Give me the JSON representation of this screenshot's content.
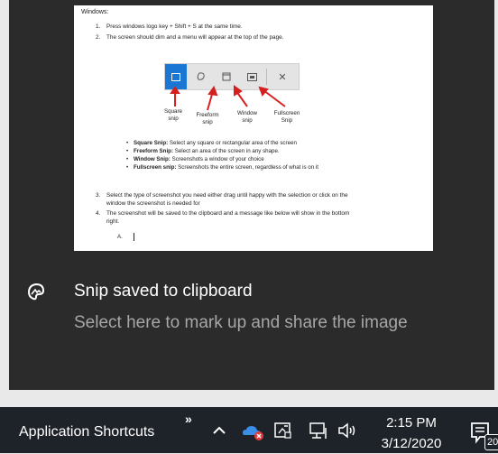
{
  "toast": {
    "title": "Snip saved to clipboard",
    "body": "Select here to mark up and share the image",
    "app_icon": "snip-sketch-icon"
  },
  "preview": {
    "heading": "Windows:",
    "steps": [
      {
        "num": "1.",
        "text": "Press windows logo key + Shift + S at the same time."
      },
      {
        "num": "2.",
        "text": "The screen should dim and a menu will appear at the top of the page."
      },
      {
        "num": "3.",
        "text": "Select the type of screenshot you need either drag until happy with the selection or click on the",
        "text2": "window the screenshot is needed for"
      },
      {
        "num": "4.",
        "text": "The screenshot will be saved to the clipboard and a message like below will show in the bottom",
        "text2": "right."
      }
    ],
    "snip_modes": [
      {
        "label_1": "Square",
        "label_2": "snip"
      },
      {
        "label_1": "Freeform",
        "label_2": "snip"
      },
      {
        "label_1": "Window",
        "label_2": "snip"
      },
      {
        "label_1": "Fullscreen",
        "label_2": "Snip"
      }
    ],
    "bullets": [
      {
        "term": "Square Snip:",
        "desc": " Select any square or rectangular area of the screen"
      },
      {
        "term": "Freeform Snip:",
        "desc": " Select an area of the screen in any shape."
      },
      {
        "term": "Window Snip:",
        "desc": " Screenshots a window of your choice"
      },
      {
        "term": "Fullscreen snip:",
        "desc": " Screenshots the entire screen, regardless of what is on it"
      }
    ],
    "sub_item": "A.",
    "accent": "#1a78d4",
    "arrow_color": "#d62020"
  },
  "taskbar": {
    "toolbar_label": "Application Shortcuts",
    "chevron": "»",
    "time": "2:15 PM",
    "date": "3/12/2020",
    "notification_count": "20",
    "background": "#1e2229"
  }
}
